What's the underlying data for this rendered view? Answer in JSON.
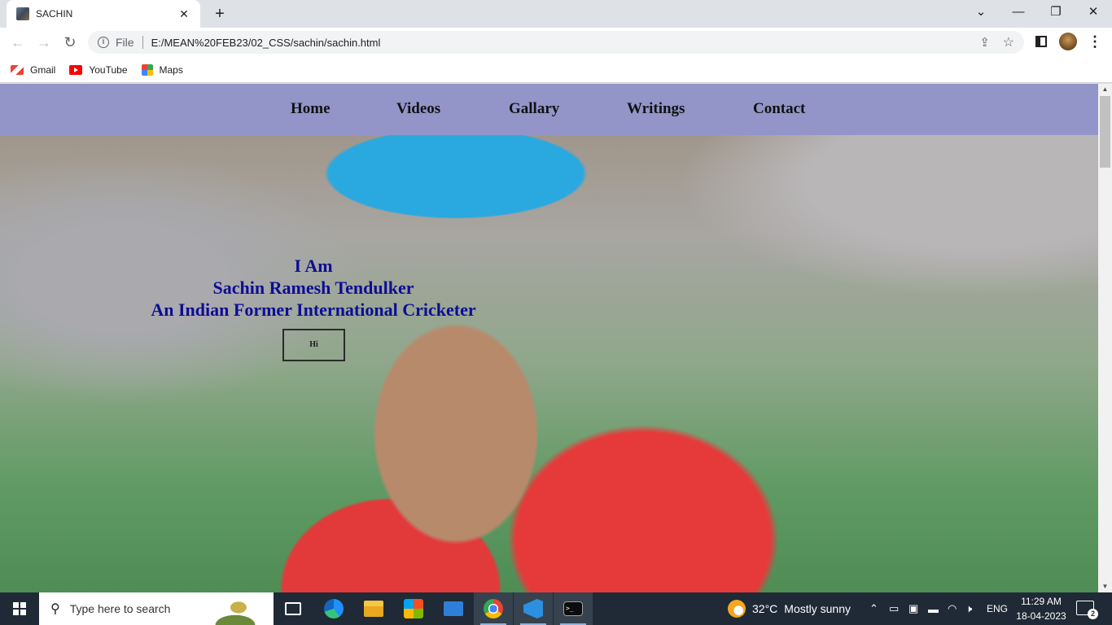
{
  "browser": {
    "tab_title": "SACHIN",
    "tab_close": "✕",
    "new_tab": "+",
    "address_scheme": "File",
    "address_url": "E:/MEAN%20FEB23/02_CSS/sachin/sachin.html",
    "window_controls": {
      "chevron": "⌄",
      "minimize": "—",
      "restore": "❐",
      "close": "✕"
    },
    "bookmarks": [
      {
        "label": "Gmail",
        "icon": "gmail-icon"
      },
      {
        "label": "YouTube",
        "icon": "youtube-icon"
      },
      {
        "label": "Maps",
        "icon": "maps-icon"
      }
    ]
  },
  "page": {
    "nav": [
      "Home",
      "Videos",
      "Gallary",
      "Writings",
      "Contact"
    ],
    "hero": {
      "line1": "I Am",
      "line2": "Sachin Ramesh Tendulker",
      "line3": "An Indian Former International Cricketer",
      "button_label": "Hi"
    },
    "colors": {
      "navbar": "#9395c9",
      "heading": "#0d0d94"
    }
  },
  "taskbar": {
    "search_placeholder": "Type here to search",
    "weather_temp": "32°C",
    "weather_condition": "Mostly sunny",
    "language": "ENG",
    "time": "11:29 AM",
    "date": "18-04-2023",
    "notifications": "2"
  }
}
